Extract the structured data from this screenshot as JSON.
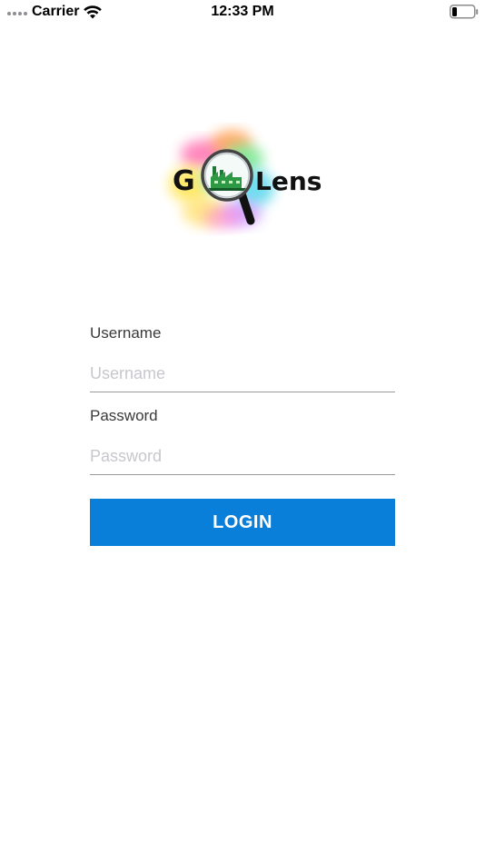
{
  "status_bar": {
    "carrier": "Carrier",
    "time": "12:33 PM"
  },
  "logo": {
    "letter_g": "G",
    "word_lens": "Lens",
    "icon": "magnifier-factory-icon"
  },
  "form": {
    "username_label": "Username",
    "username_placeholder": "Username",
    "username_value": "",
    "password_label": "Password",
    "password_placeholder": "Password",
    "password_value": "",
    "login_label": "LOGIN"
  },
  "colors": {
    "button_bg": "#0a7fd9",
    "button_text": "#ffffff",
    "label_text": "#3a3a3c",
    "placeholder": "#c7c7cd",
    "underline": "#9a9a9a"
  }
}
